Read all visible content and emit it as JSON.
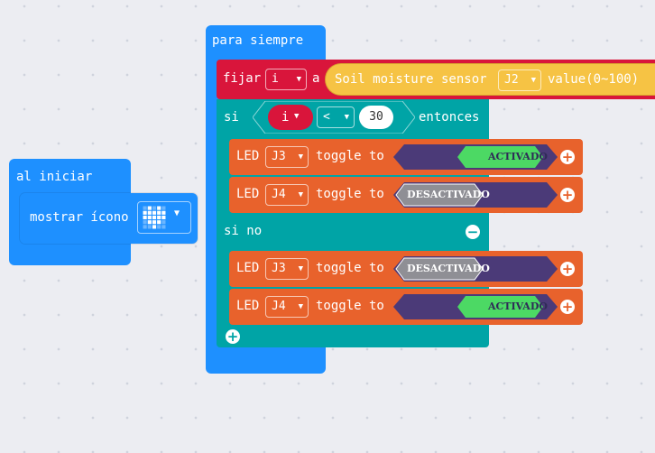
{
  "start_event": {
    "title": "al iniciar",
    "show_icon_label": "mostrar ícono",
    "icon_name": "heart-icon"
  },
  "forever": {
    "title": "para siempre",
    "set": {
      "fijar_label": "fijar",
      "variable": "i",
      "to_label": "a",
      "sensor_label": "Soil moisture sensor",
      "pin": "J2",
      "value_label": "value(0~100)"
    },
    "if": {
      "si_label": "si",
      "left_var": "i",
      "operator": "<",
      "right_value": "30",
      "then_label": "entonces",
      "else_label": "si no"
    },
    "then_leds": [
      {
        "led_label": "LED",
        "pin": "J3",
        "action": "toggle to",
        "state": "ACTIVADO",
        "state_type": "on"
      },
      {
        "led_label": "LED",
        "pin": "J4",
        "action": "toggle to",
        "state": "DESACTIVADO",
        "state_type": "off"
      }
    ],
    "else_leds": [
      {
        "led_label": "LED",
        "pin": "J3",
        "action": "toggle to",
        "state": "DESACTIVADO",
        "state_type": "off"
      },
      {
        "led_label": "LED",
        "pin": "J4",
        "action": "toggle to",
        "state": "ACTIVADO",
        "state_type": "on"
      }
    ]
  },
  "colors": {
    "workspace": "#ecedf2",
    "basic_blue": "#1e90ff",
    "variables_red": "#d9153b",
    "logic_teal": "#00a4a6",
    "led_orange": "#e8622c",
    "sensor_yellow": "#f6c344",
    "toggle_purple": "#4b3a78",
    "active_green": "#4cd964",
    "inactive_gray": "#8f8f95"
  }
}
